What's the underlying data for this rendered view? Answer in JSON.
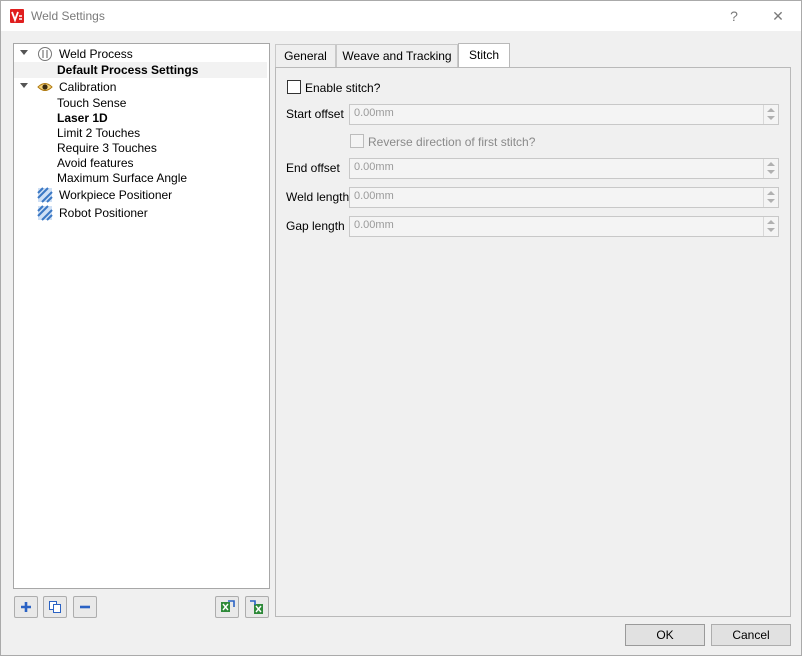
{
  "window": {
    "title": "Weld Settings",
    "help_label": "?",
    "close_label": "✕"
  },
  "tree": {
    "items": [
      {
        "label": "Weld Process",
        "icon": "weld-process-icon",
        "expanded": true
      },
      {
        "label": "Default Process Settings",
        "bold": true,
        "selected": true
      },
      {
        "label": "Calibration",
        "icon": "eye-icon",
        "expanded": true
      },
      {
        "label": "Touch Sense"
      },
      {
        "label": "Laser 1D",
        "bold": true
      },
      {
        "label": "Limit 2 Touches"
      },
      {
        "label": "Require 3 Touches"
      },
      {
        "label": "Avoid features"
      },
      {
        "label": "Maximum Surface Angle"
      },
      {
        "label": "Workpiece Positioner",
        "icon": "positioner-icon"
      },
      {
        "label": "Robot Positioner",
        "icon": "positioner-icon"
      }
    ]
  },
  "toolbar": {
    "buttons": [
      "add-icon",
      "copy-icon",
      "remove-icon",
      "import-icon",
      "export-icon"
    ]
  },
  "tabs": [
    {
      "label": "General",
      "active": false
    },
    {
      "label": "Weave and Tracking",
      "active": false
    },
    {
      "label": "Stitch",
      "active": true
    }
  ],
  "stitch": {
    "enable_label": "Enable stitch?",
    "start_offset_label": "Start offset",
    "start_offset_value": "0.00mm",
    "reverse_label": "Reverse direction of first stitch?",
    "end_offset_label": "End offset",
    "end_offset_value": "0.00mm",
    "weld_length_label": "Weld length",
    "weld_length_value": "0.00mm",
    "gap_length_label": "Gap length",
    "gap_length_value": "0.00mm"
  },
  "buttons": {
    "ok": "OK",
    "cancel": "Cancel"
  },
  "colors": {
    "app_icon": "#e01e1e",
    "positioner_icon": "#3b78c4"
  }
}
